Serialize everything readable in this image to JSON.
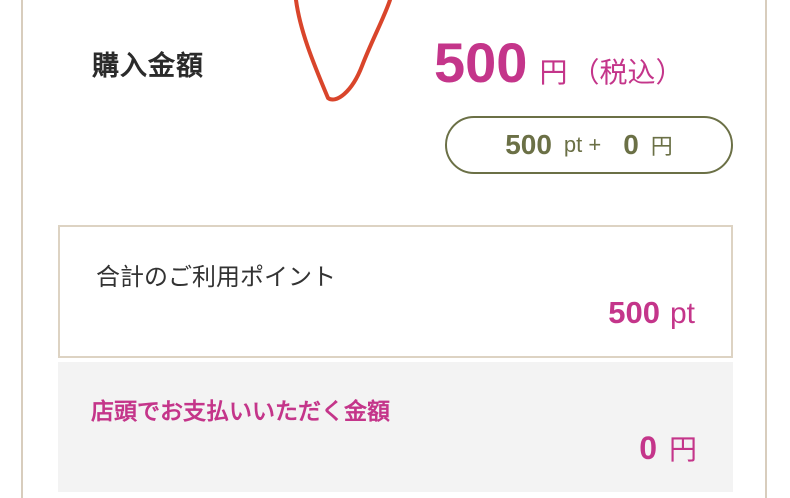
{
  "purchase": {
    "label": "購入金額",
    "amount": "500",
    "unit": "円",
    "tax_note": "（税込）"
  },
  "breakdown": {
    "points": "500",
    "points_unit": "pt +",
    "cash": "0",
    "cash_unit": "円"
  },
  "points_used": {
    "title": "合計のご利用ポイント",
    "value": "500",
    "unit": "pt"
  },
  "store_payment": {
    "title": "店頭でお支払いいただく金額",
    "value": "0",
    "unit": "円"
  },
  "colors": {
    "accent": "#c4358a",
    "olive": "#6b7046",
    "border": "#ddd3c3",
    "annotation": "#d9452b"
  }
}
